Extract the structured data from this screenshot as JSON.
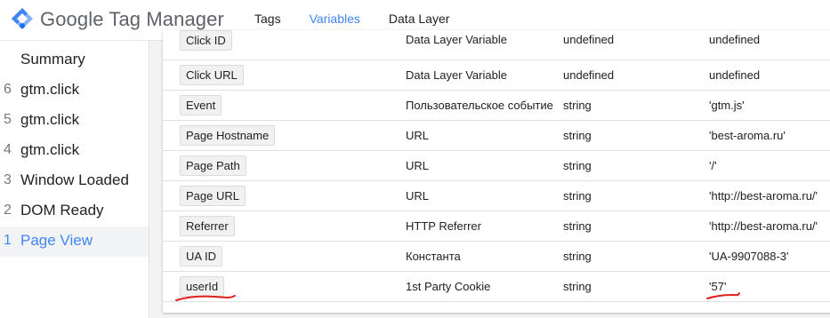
{
  "app": {
    "brand_google": "Google",
    "brand_product": "Tag Manager"
  },
  "tabs": [
    {
      "label": "Tags",
      "active": false
    },
    {
      "label": "Variables",
      "active": true
    },
    {
      "label": "Data Layer",
      "active": false
    }
  ],
  "sidebar": {
    "items": [
      {
        "num": "",
        "label": "Summary",
        "active": false
      },
      {
        "num": "6",
        "label": "gtm.click",
        "active": false
      },
      {
        "num": "5",
        "label": "gtm.click",
        "active": false
      },
      {
        "num": "4",
        "label": "gtm.click",
        "active": false
      },
      {
        "num": "3",
        "label": "Window Loaded",
        "active": false
      },
      {
        "num": "2",
        "label": "DOM Ready",
        "active": false
      },
      {
        "num": "1",
        "label": "Page View",
        "active": true
      }
    ]
  },
  "variables": {
    "rows": [
      {
        "name": "Click ID",
        "type": "Data Layer Variable",
        "return_type": "undefined",
        "value": "undefined"
      },
      {
        "name": "Click URL",
        "type": "Data Layer Variable",
        "return_type": "undefined",
        "value": "undefined"
      },
      {
        "name": "Event",
        "type": "Пользовательское событие",
        "return_type": "string",
        "value": "'gtm.js'"
      },
      {
        "name": "Page Hostname",
        "type": "URL",
        "return_type": "string",
        "value": "'best-aroma.ru'"
      },
      {
        "name": "Page Path",
        "type": "URL",
        "return_type": "string",
        "value": "'/'"
      },
      {
        "name": "Page URL",
        "type": "URL",
        "return_type": "string",
        "value": "'http://best-aroma.ru/'"
      },
      {
        "name": "Referrer",
        "type": "HTTP Referrer",
        "return_type": "string",
        "value": "'http://best-aroma.ru/'"
      },
      {
        "name": "UA ID",
        "type": "Константа",
        "return_type": "string",
        "value": "'UA-9907088-3'"
      },
      {
        "name": "userId",
        "type": "1st Party Cookie",
        "return_type": "string",
        "value": "'57'"
      }
    ]
  },
  "colors": {
    "accent": "#4285f4",
    "annotation": "#e0201b"
  }
}
